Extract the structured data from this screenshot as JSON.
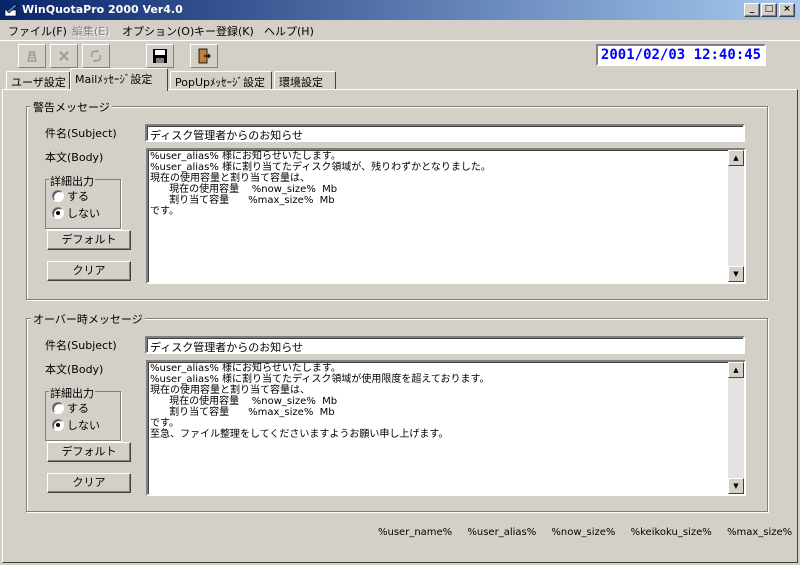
{
  "window": {
    "title": "WinQuotaPro 2000 Ver4.0",
    "controls": {
      "minimize": "_",
      "maximize": "□",
      "close": "×"
    }
  },
  "menu": [
    {
      "label": "ファイル(F)",
      "disabled": false
    },
    {
      "label": "編集(E)",
      "disabled": true
    },
    {
      "label": "オプション(O)",
      "disabled": false
    },
    {
      "label": "キー登録(K)",
      "disabled": false
    },
    {
      "label": "ヘルプ(H)",
      "disabled": false
    }
  ],
  "toolbar": {
    "icons": [
      "recycle-icon-disabled",
      "cancel-icon-disabled",
      "undo-icon-disabled",
      "save-icon",
      "exit-icon"
    ],
    "datetime": "2001/02/03 12:40:45"
  },
  "tabs": [
    {
      "label": "ユーザ設定",
      "active": false
    },
    {
      "label": "Mailﾒｯｾｰｼﾞ設定",
      "active": true
    },
    {
      "label": "PopUpﾒｯｾｰｼﾞ設定",
      "active": false
    },
    {
      "label": "環境設定",
      "active": false
    }
  ],
  "warning": {
    "group_title": "警告メッセージ",
    "subject_label": "件名(Subject)",
    "subject_value": "ディスク管理者からのお知らせ",
    "body_label": "本文(Body)",
    "body_text": "%user_alias% 様にお知らせいたします。\n%user_alias% 様に割り当てたディスク領域が、残りわずかとなりました。\n現在の使用容量と割り当て容量は、\n      現在の使用容量    %now_size%  Mb\n      割り当て容量      %max_size%  Mb\nです。",
    "detail_legend": "詳細出力",
    "radio_yes": "する",
    "radio_no": "しない",
    "default_button": "デフォルト",
    "clear_button": "クリア"
  },
  "over": {
    "group_title": "オーバー時メッセージ",
    "subject_label": "件名(Subject)",
    "subject_value": "ディスク管理者からのお知らせ",
    "body_label": "本文(Body)",
    "body_text": "%user_alias% 様にお知らせいたします。\n%user_alias% 様に割り当てたディスク領域が使用限度を超えております。\n現在の使用容量と割り当て容量は、\n      現在の使用容量    %now_size%  Mb\n      割り当て容量      %max_size%  Mb\nです。\n至急、ファイル整理をしてくださいますようお願い申し上げます。",
    "detail_legend": "詳細出力",
    "radio_yes": "する",
    "radio_no": "しない",
    "default_button": "デフォルト",
    "clear_button": "クリア"
  },
  "variables": [
    "%user_name%",
    "%user_alias%",
    "%now_size%",
    "%keikoku_size%",
    "%max_size%"
  ],
  "colors": {
    "titlebar_start": "#0a246a",
    "titlebar_end": "#a6caf0",
    "datetime_text": "#0000ff",
    "face": "#d4d0c8"
  }
}
